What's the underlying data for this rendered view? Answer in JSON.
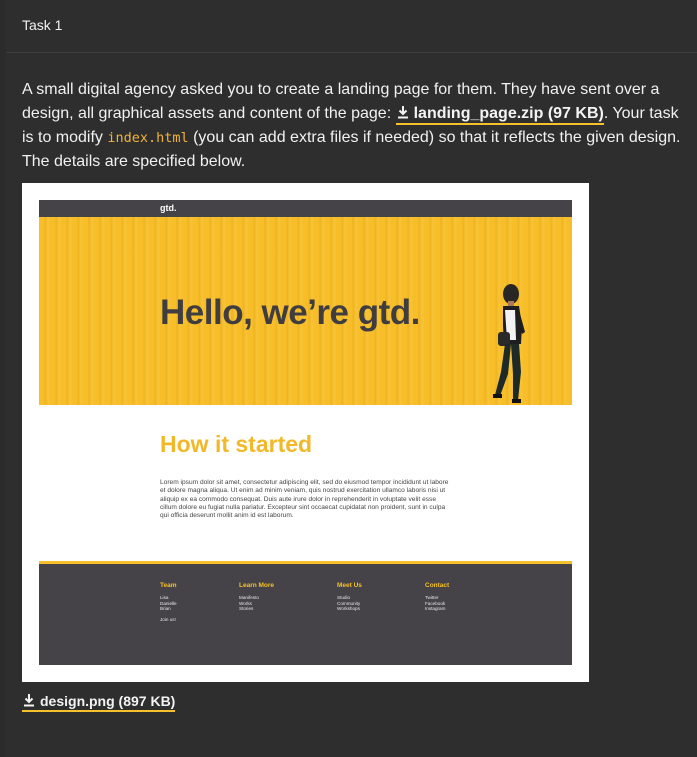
{
  "task": {
    "title": "Task 1"
  },
  "description": {
    "text_1": "A small digital agency asked you to create a landing page for them. They have sent over a design, all graphical assets and content of the page: ",
    "download_label": "landing_page.zip (97 KB)",
    "text_2": ". Your task is to modify ",
    "code_file": "index.html",
    "text_3": " (you can add extra files if needed) so that it reflects the given design. The details are specified below."
  },
  "preview": {
    "logo": "gtd.",
    "hero_title": "Hello, we’re gtd.",
    "section_title": "How it started",
    "paragraph": "Lorem ipsum dolor sit amet, consectetur adipiscing elit, sed do eiusmod tempor incididunt ut labore et dolore magna aliqua. Ut enim ad minim veniam, quis nostrud exercitation ullamco laboris nisi ut aliquip ex ea commodo consequat. Duis aute irure dolor in reprehenderit in voluptate velit esse cillum dolore eu fugiat nulla pariatur. Excepteur sint occaecat cupidatat non proident, sunt in culpa qui officia deserunt mollit anim id est laborum.",
    "footer": {
      "team": {
        "title": "Team",
        "items": [
          "Lisa",
          "Danielle",
          "Brian"
        ],
        "extra": "Join us!"
      },
      "learn": {
        "title": "Learn More",
        "items": [
          "Manifesto",
          "Works",
          "Stories"
        ]
      },
      "meet": {
        "title": "Meet Us",
        "items": [
          "Studio",
          "Community",
          "Workshops"
        ]
      },
      "contact": {
        "title": "Contact",
        "items": [
          "Twitter",
          "Facebook",
          "Instagram"
        ]
      }
    }
  },
  "bottom_download": {
    "label": "design.png (897 KB)"
  },
  "colors": {
    "accent": "#f6c12a",
    "dark": "#454347",
    "background": "#2e2e2e"
  },
  "icons": {
    "download": "download-icon"
  }
}
